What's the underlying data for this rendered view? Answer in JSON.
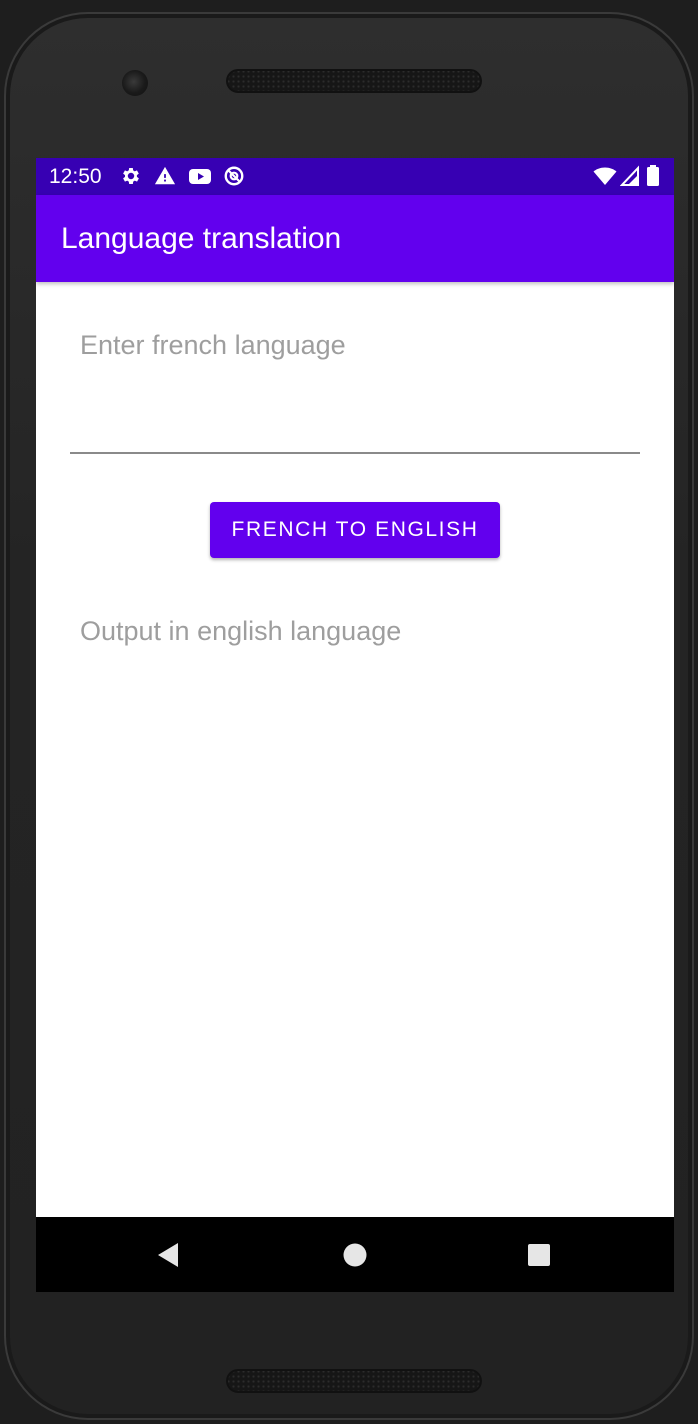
{
  "status_bar": {
    "time": "12:50",
    "icons": [
      "settings-icon",
      "warning-icon",
      "youtube-icon",
      "sync-icon",
      "wifi-icon",
      "signal-icon",
      "battery-icon"
    ],
    "color": "#3700b3"
  },
  "app_bar": {
    "title": "Language translation",
    "color": "#6200ee"
  },
  "main": {
    "input": {
      "value": "",
      "placeholder": "Enter french language"
    },
    "convert_button_label": "French to English",
    "output_text": "Output in english language"
  },
  "nav_bar": {
    "buttons": [
      "back-icon",
      "home-icon",
      "recents-icon"
    ]
  },
  "colors": {
    "accent": "#6200ee",
    "status": "#3700b3",
    "hint_text": "#9e9e9e"
  }
}
